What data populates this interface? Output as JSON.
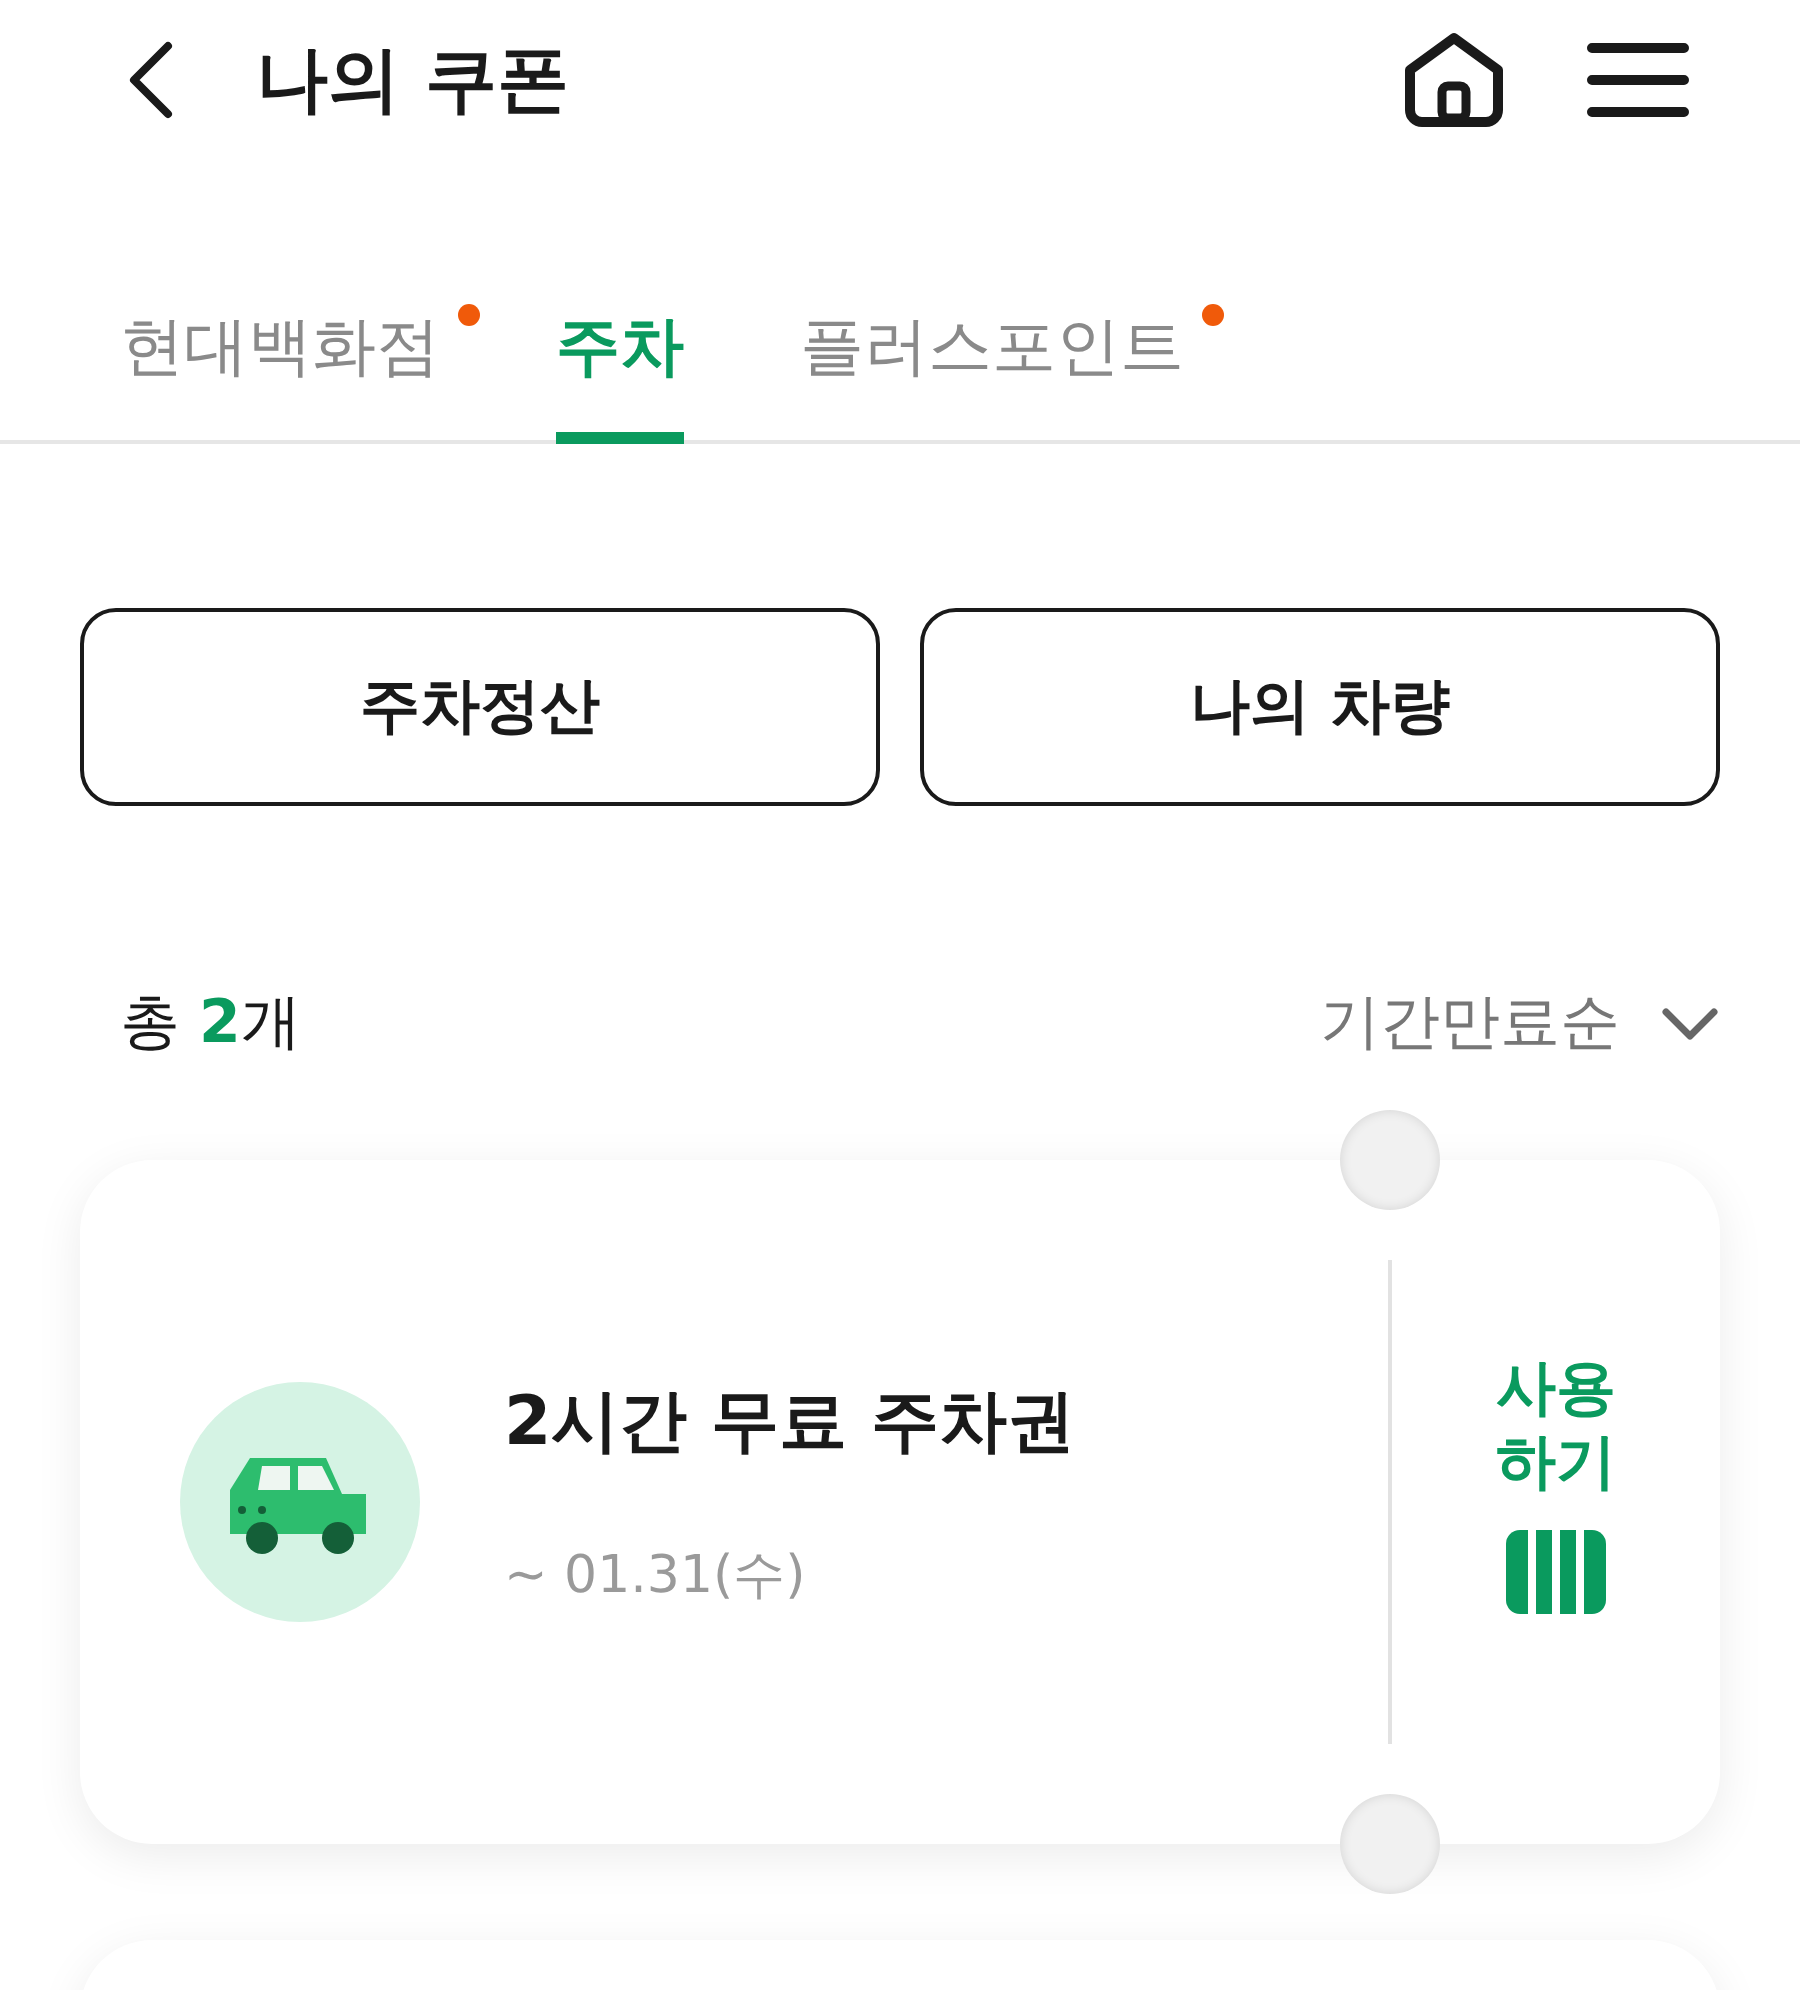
{
  "header": {
    "title": "나의 쿠폰"
  },
  "tabs": [
    {
      "label": "현대백화점",
      "selected": false,
      "new_dot": true
    },
    {
      "label": "주차",
      "selected": true,
      "new_dot": false
    },
    {
      "label": "플러스포인트",
      "selected": false,
      "new_dot": true
    }
  ],
  "actions": [
    "주차정산",
    "나의 차량"
  ],
  "summary": {
    "text": "총 **2**개",
    "sort": "기간만료순"
  },
  "coupons": [
    {
      "kind": "full",
      "title": "2시간 무료 주차권",
      "expiry": "~ 01.31(수)",
      "use_label": [
        "사용",
        "하기"
      ]
    },
    {
      "kind": "partial"
    }
  ]
}
